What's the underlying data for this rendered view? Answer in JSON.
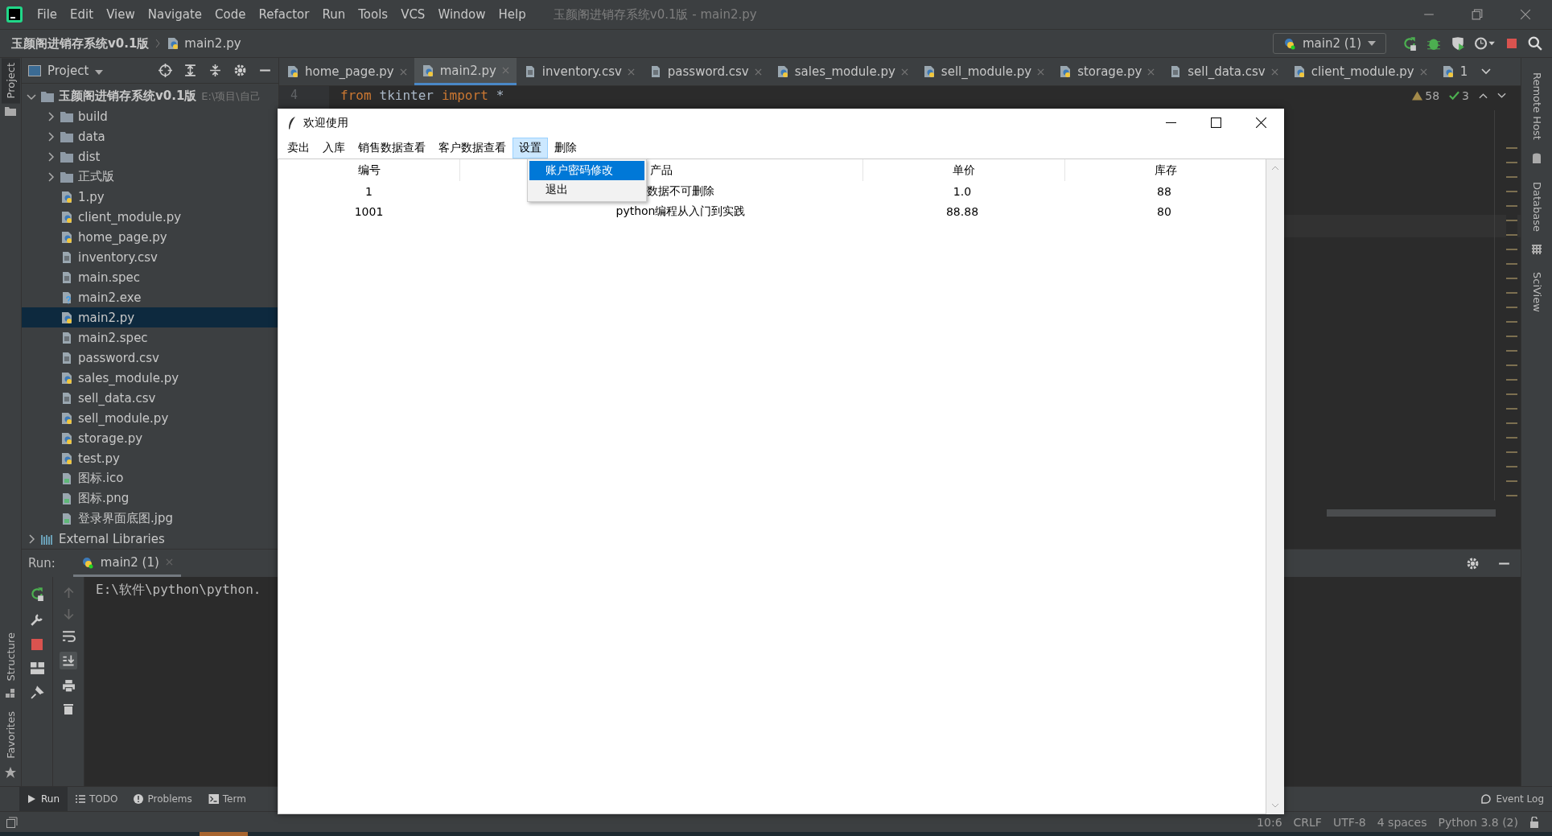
{
  "ide": {
    "menu": [
      "File",
      "Edit",
      "View",
      "Navigate",
      "Code",
      "Refactor",
      "Run",
      "Tools",
      "VCS",
      "Window",
      "Help"
    ],
    "window_title": "玉颜阁进销存系统v0.1版 - main2.py",
    "breadcrumb": [
      "玉颜阁进销存系统v0.1版",
      "main2.py"
    ],
    "run_config": "main2 (1)",
    "project_panel": {
      "title": "Project",
      "root": {
        "name": "玉颜阁进销存系统v0.1版",
        "path": "E:\\项目\\自己",
        "expanded": true,
        "children": [
          {
            "name": "build",
            "kind": "folder",
            "expanded": false,
            "selected": false
          },
          {
            "name": "data",
            "kind": "folder",
            "expanded": false,
            "selected": false
          },
          {
            "name": "dist",
            "kind": "folder",
            "expanded": false,
            "selected": false
          },
          {
            "name": "正式版",
            "kind": "folder",
            "expanded": false,
            "selected": false
          },
          {
            "name": "1.py",
            "kind": "py",
            "selected": false
          },
          {
            "name": "client_module.py",
            "kind": "py",
            "selected": false
          },
          {
            "name": "home_page.py",
            "kind": "py",
            "selected": false
          },
          {
            "name": "inventory.csv",
            "kind": "text",
            "selected": false
          },
          {
            "name": "main.spec",
            "kind": "text",
            "selected": false
          },
          {
            "name": "main2.exe",
            "kind": "unknown",
            "selected": false
          },
          {
            "name": "main2.py",
            "kind": "py",
            "selected": true
          },
          {
            "name": "main2.spec",
            "kind": "text",
            "selected": false
          },
          {
            "name": "password.csv",
            "kind": "text",
            "selected": false
          },
          {
            "name": "sales_module.py",
            "kind": "py",
            "selected": false
          },
          {
            "name": "sell_data.csv",
            "kind": "text",
            "selected": false
          },
          {
            "name": "sell_module.py",
            "kind": "py",
            "selected": false
          },
          {
            "name": "storage.py",
            "kind": "py",
            "selected": false
          },
          {
            "name": "test.py",
            "kind": "py",
            "selected": false
          },
          {
            "name": "图标.ico",
            "kind": "image",
            "selected": false
          },
          {
            "name": "图标.png",
            "kind": "image",
            "selected": false
          },
          {
            "name": "登录界面底图.jpg",
            "kind": "image",
            "selected": false
          }
        ]
      },
      "external": "External Libraries"
    },
    "tabs": [
      {
        "label": "home_page.py",
        "kind": "py",
        "selected": false
      },
      {
        "label": "main2.py",
        "kind": "py",
        "selected": true
      },
      {
        "label": "inventory.csv",
        "kind": "text",
        "selected": false
      },
      {
        "label": "password.csv",
        "kind": "text",
        "selected": false
      },
      {
        "label": "sales_module.py",
        "kind": "py",
        "selected": false
      },
      {
        "label": "sell_module.py",
        "kind": "py",
        "selected": false
      },
      {
        "label": "storage.py",
        "kind": "py",
        "selected": false
      },
      {
        "label": "sell_data.csv",
        "kind": "text",
        "selected": false
      },
      {
        "label": "client_module.py",
        "kind": "py",
        "selected": false
      }
    ],
    "tab_overflow": "1",
    "editor": {
      "line_number": "4",
      "tokens": [
        {
          "text": "from",
          "kind": "keyword"
        },
        {
          "text": "tkinter",
          "kind": "name"
        },
        {
          "text": "import",
          "kind": "keyword"
        },
        {
          "text": "*",
          "kind": "name"
        }
      ]
    },
    "inspections": {
      "warnings": "58",
      "checks": "3"
    },
    "left_stripe": [
      {
        "label": "Project",
        "selected": true
      },
      {
        "label": "Structure",
        "selected": false
      },
      {
        "label": "Favorites",
        "selected": false
      }
    ],
    "right_stripe": [
      "Remote Host",
      "Database",
      "SciView"
    ],
    "run_panel": {
      "label": "Run:",
      "tab": "main2 (1)",
      "console": "E:\\软件\\python\\python."
    },
    "bottom_tabs": [
      {
        "label": "Run",
        "selected": true
      },
      {
        "label": "TODO",
        "selected": false
      },
      {
        "label": "Problems",
        "selected": false
      },
      {
        "label": "Term",
        "selected": false
      }
    ],
    "event_log": "Event Log",
    "status_bar": [
      "10:6",
      "CRLF",
      "UTF-8",
      "4 spaces",
      "Python 3.8 (2)"
    ]
  },
  "app_window": {
    "title": "欢迎使用",
    "menu": [
      {
        "label": "卖出",
        "selected": false
      },
      {
        "label": "入库",
        "selected": false
      },
      {
        "label": "销售数据查看",
        "selected": false
      },
      {
        "label": "客户数据查看",
        "selected": false
      },
      {
        "label": "设置",
        "selected": true
      },
      {
        "label": "删除",
        "selected": false
      }
    ],
    "dropdown": [
      {
        "label": "账户密码修改",
        "selected": true
      },
      {
        "label": "退出",
        "selected": false
      }
    ],
    "table": {
      "columns": [
        "编号",
        "产品",
        "单价",
        "库存"
      ],
      "rows": [
        [
          "1",
          "数据不可删除",
          "1.0",
          "88"
        ],
        [
          "1001",
          "python编程从入门到实践",
          "88.88",
          "80"
        ]
      ]
    }
  }
}
